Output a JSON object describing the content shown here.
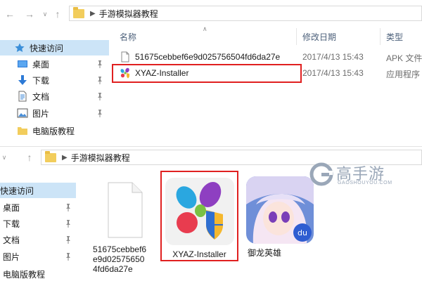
{
  "top": {
    "breadcrumb": {
      "folder": "手游模拟器教程"
    },
    "sidebar": [
      {
        "label": "快速访问",
        "selected": true,
        "icon": "star-icon"
      },
      {
        "label": "桌面",
        "icon": "desktop-icon",
        "pinned": true
      },
      {
        "label": "下载",
        "icon": "download-icon",
        "pinned": true
      },
      {
        "label": "文档",
        "icon": "document-icon",
        "pinned": true
      },
      {
        "label": "图片",
        "icon": "picture-icon",
        "pinned": true
      },
      {
        "label": "电脑版教程",
        "icon": "folder-icon"
      }
    ],
    "columns": {
      "name": "名称",
      "date": "修改日期",
      "type": "类型"
    },
    "files": [
      {
        "name": "51675cebbef6e9d025756504fd6da27e",
        "date": "2017/4/13 15:43",
        "type": "APK 文件"
      },
      {
        "name": "XYAZ-Installer",
        "date": "2017/4/13 15:43",
        "type": "应用程序"
      }
    ]
  },
  "bottom": {
    "breadcrumb": {
      "folder": "手游模拟器教程"
    },
    "sidebar": [
      {
        "label": "快速访问",
        "selected": true
      },
      {
        "label": "桌面",
        "pinned": true
      },
      {
        "label": "下载",
        "pinned": true
      },
      {
        "label": "文档",
        "pinned": true
      },
      {
        "label": "图片",
        "pinned": true
      },
      {
        "label": "电脑版教程"
      }
    ],
    "tiles": [
      {
        "caption": "51675cebbef6e9d025756504fd6da27e",
        "icon": "blank-file-icon"
      },
      {
        "caption": "XYAZ-Installer",
        "icon": "xyaz-app-icon"
      },
      {
        "caption": "御龙英雄",
        "icon": "game-app-icon"
      }
    ]
  },
  "watermark": {
    "title": "高手游",
    "sub": "GAOSHOUYOU.COM"
  },
  "colors": {
    "selection": "#cce4f7",
    "highlight": "#e02020",
    "folder": "#f2cd5c",
    "header_text": "#4c607a"
  }
}
